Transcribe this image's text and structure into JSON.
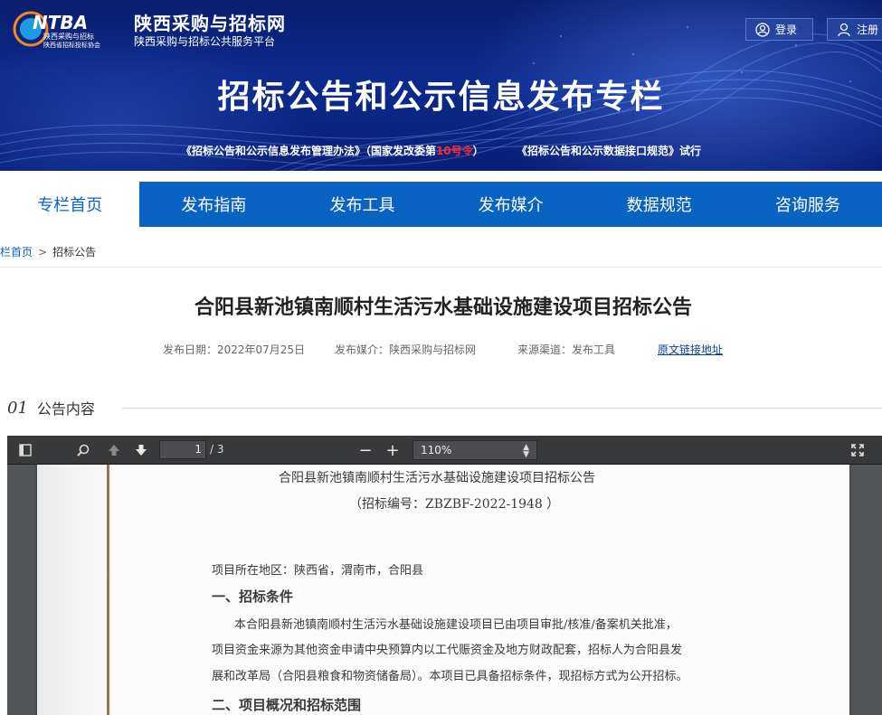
{
  "header": {
    "logo_text": "NTBA",
    "logo_caption_line1": "陕西采购与招标",
    "logo_caption_line2": "陕西省招标投标协会",
    "site_name": "陕西采购与招标网",
    "site_subtitle": "陕西采购与招标公共服务平台",
    "login_label": "登录",
    "register_label": "注册",
    "banner_title": "招标公告和公示信息发布专栏",
    "link1_prefix": "《招标公告和公示信息发布管理办法》（国家发改委第",
    "link1_highlight": "10号令",
    "link1_suffix": "）",
    "link2": "《招标公告和公示数据接口规范》试行"
  },
  "nav": {
    "items": [
      {
        "label": "专栏首页",
        "active": true
      },
      {
        "label": "发布指南"
      },
      {
        "label": "发布工具"
      },
      {
        "label": "发布媒介"
      },
      {
        "label": "数据规范"
      },
      {
        "label": "咨询服务"
      }
    ]
  },
  "breadcrumb": {
    "home": "栏首页",
    "separator": ">",
    "current": "招标公告"
  },
  "article": {
    "title": "合阳县新池镇南顺村生活污水基础设施建设项目招标公告",
    "publish_date": "发布日期：2022年07月25日",
    "publish_media": "发布媒介：陕西采购与招标网",
    "source": "来源渠道：发布工具",
    "original_link": "原文链接地址"
  },
  "section": {
    "number": "01",
    "label": "公告内容"
  },
  "pdf_viewer": {
    "current_page": "1",
    "total_pages": "/ 3",
    "zoom": "110%",
    "zoom_in": "+",
    "zoom_out": "−"
  },
  "document": {
    "title": "合阳县新池镇南顺村生活污水基础设施建设项目招标公告",
    "code": "（招标编号：ZBZBF-2022-1948 ）",
    "region": "项目所在地区：陕西省，渭南市，合阳县",
    "heading1": "一、招标条件",
    "para_line1": "本合阳县新池镇南顺村生活污水基础设施建设项目已由项目审批/核准/备案机关批准，",
    "para_line2": "项目资金来源为其他资金申请中央预算内以工代赈资金及地方财政配套，招标人为合阳县发",
    "para_line3": "展和改革局（合阳县粮食和物资储备局）。本项目已具备招标条件，现招标方式为公开招标。",
    "heading2": "二、项目概况和招标范围"
  },
  "colors": {
    "banner": "#0d2a8c",
    "nav": "#0a63c2",
    "highlight_red": "#ff2a2a",
    "viewer_bg": "#525659",
    "toolbar": "#38393b"
  }
}
